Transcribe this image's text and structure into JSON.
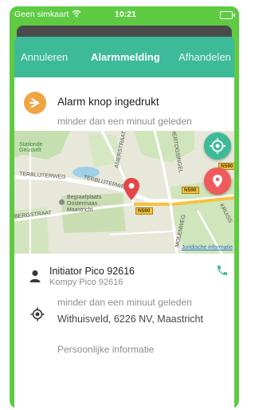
{
  "status_bar": {
    "carrier": "Geen simkaart",
    "time": "10:21"
  },
  "header": {
    "cancel": "Annuleren",
    "title": "Alarmmelding",
    "done": "Afhandelen"
  },
  "alarm": {
    "title": "Alarm knop ingedrukt",
    "time": "minder dan een minuut geleden"
  },
  "map": {
    "labels": {
      "station": "Stationde Geusselt",
      "street1": "TERBLIJTERWEG",
      "street2": "TERBLIJTERWEG",
      "street3": "AMERSTRAAT",
      "street4": "HERTOGSINGEL",
      "street5": "BERGSTRAAT",
      "cemetery_line1": "Begraafplaats",
      "cemetery_line2": "Oostermaas",
      "cemetery_line3": "Maastricht",
      "molenweg": "MOLENWEG",
      "kruiss": "KRUISS"
    },
    "road_tags": [
      "N590",
      "N590",
      "N590"
    ],
    "legal": "Juridische informatie"
  },
  "initiator": {
    "name": "Initiator Pico 92616",
    "sub": "Kompy Pico 92616"
  },
  "location": {
    "time": "minder dan een minuut geleden",
    "address": "Withuisveld, 6226 NV, Maastricht"
  },
  "personal_info": "Persoonlijke informatie",
  "colors": {
    "brand_green": "#5ecb43",
    "header_teal": "#3dba97",
    "alarm_orange": "#f0a543",
    "pin_red": "#f05a5a"
  }
}
